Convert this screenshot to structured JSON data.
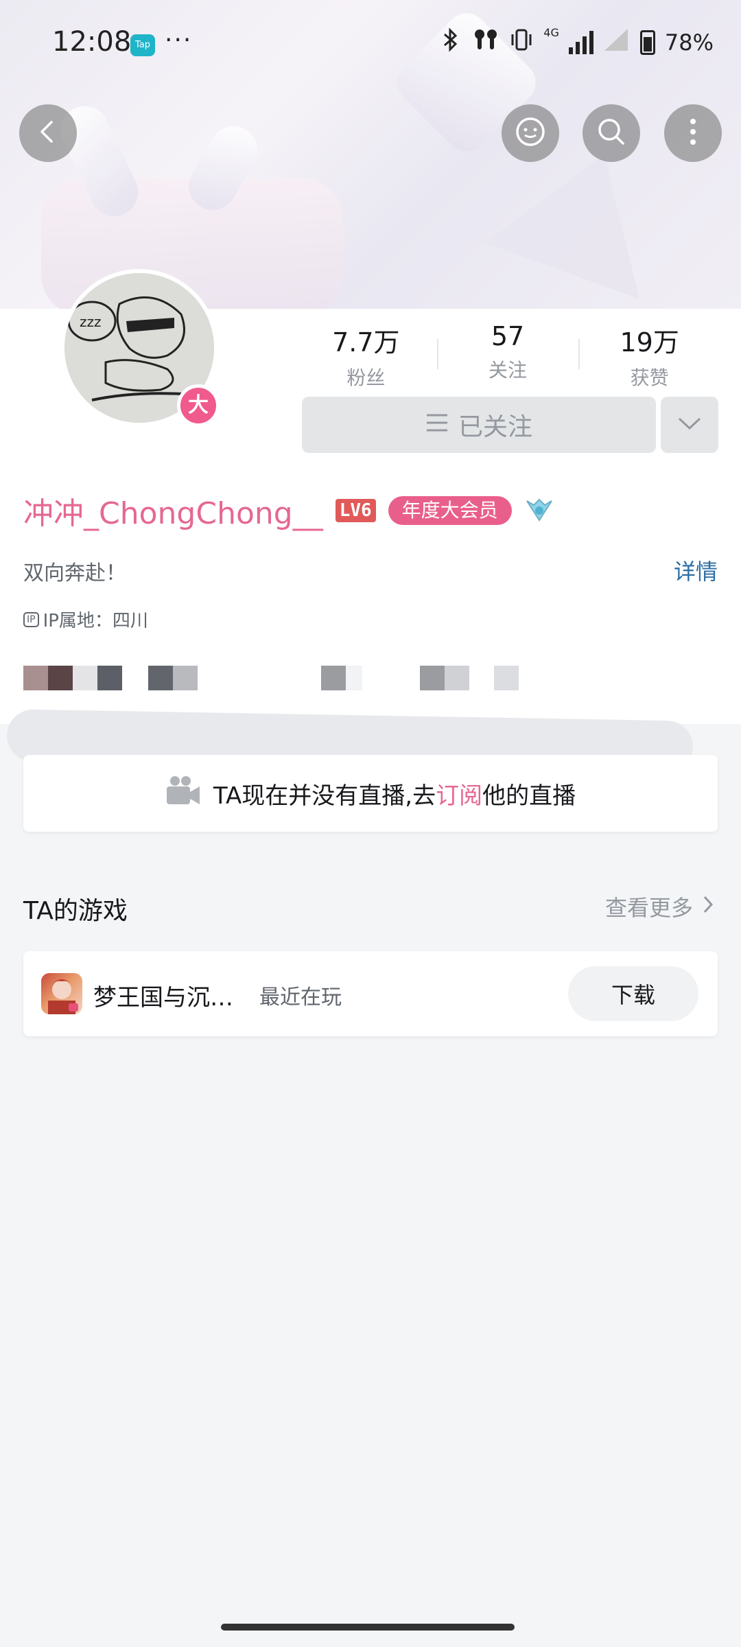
{
  "status_bar": {
    "time": "12:08",
    "app_badge": "Tap",
    "more_dots": "···",
    "network": "4G",
    "battery": "78%"
  },
  "colors": {
    "accent_pink": "#e56890",
    "vip_pink": "#e95f8c",
    "link_blue": "#2e6ea3",
    "muted": "#9499a0"
  },
  "header": {
    "back_icon": "chevron-left-icon",
    "message_icon": "chat-icon",
    "search_icon": "search-icon",
    "more_icon": "vertical-dots-icon"
  },
  "profile": {
    "vip_badge": "大",
    "stats": [
      {
        "value": "7.7万",
        "label": "粉丝"
      },
      {
        "value": "57",
        "label": "关注"
      },
      {
        "value": "19万",
        "label": "获赞"
      }
    ],
    "follow_button": "已关注",
    "username": "冲冲_ChongChong__",
    "level": "LV6",
    "vip_label": "年度大会员",
    "signature": "双向奔赴！",
    "detail_link": "详情",
    "ip_tag": "IP",
    "ip_location": "IP属地：四川"
  },
  "live": {
    "prefix": "TA现在并没有直播,去",
    "link": "订阅",
    "suffix": "他的直播"
  },
  "games": {
    "title": "TA的游戏",
    "more": "查看更多",
    "items": [
      {
        "name": "梦王国与沉…",
        "status": "最近在玩",
        "action": "下载"
      }
    ]
  }
}
